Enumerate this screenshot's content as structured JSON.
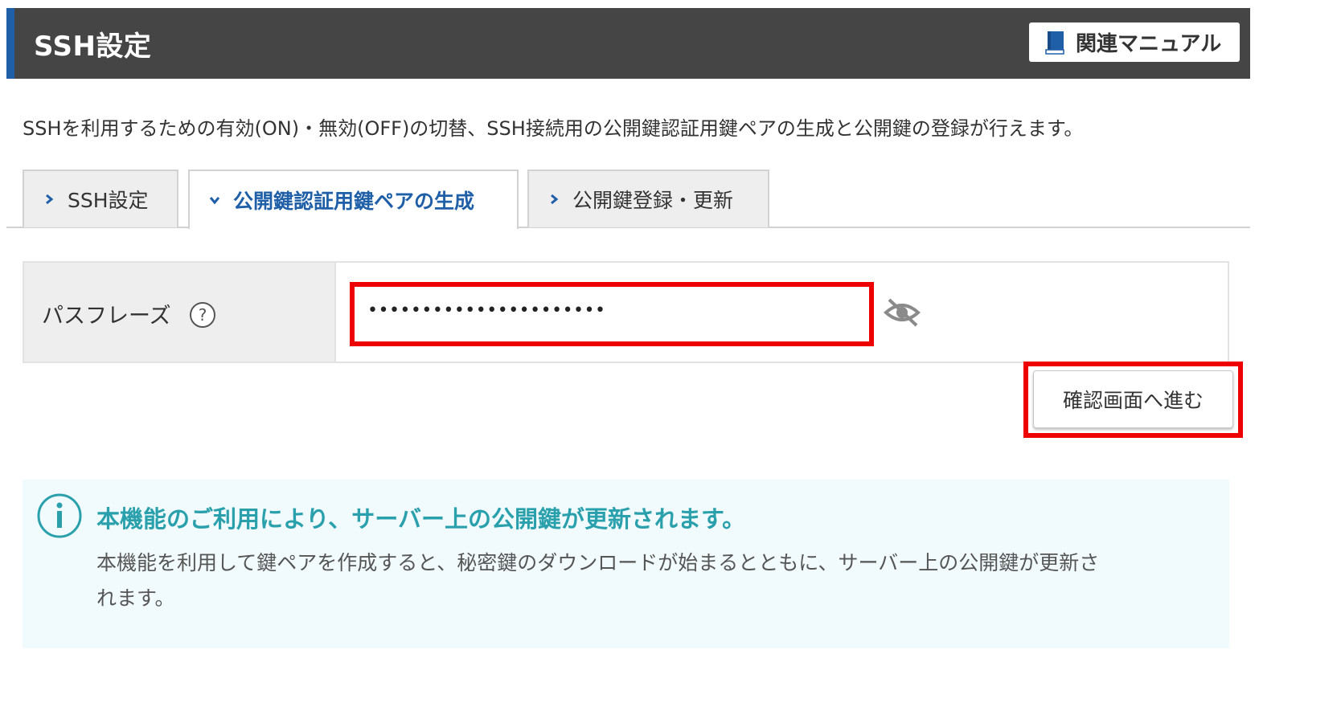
{
  "header": {
    "title": "SSH設定",
    "manual_label": "関連マニュアル",
    "manual_icon": "book-icon"
  },
  "description": "SSHを利用するための有効(ON)・無効(OFF)の切替、SSH接続用の公開鍵認証用鍵ペアの生成と公開鍵の登録が行えます。",
  "tabs": [
    {
      "label": "SSH設定",
      "active": false
    },
    {
      "label": "公開鍵認証用鍵ペアの生成",
      "active": true
    },
    {
      "label": "公開鍵登録・更新",
      "active": false
    }
  ],
  "form": {
    "passphrase_label": "パスフレーズ",
    "help_icon": "question-circle-icon",
    "passphrase_value": "••••••••••••••••••••••",
    "visibility_icon": "eye-slash-icon"
  },
  "confirm_button": "確認画面へ進む",
  "notice": {
    "icon": "info-icon",
    "title": "本機能のご利用により、サーバー上の公開鍵が更新されます。",
    "body_line1": "本機能を利用して鍵ペアを作成すると、秘密鍵のダウンロードが始まるとともに、サーバー上の公開鍵が更新さ",
    "body_line2": "れます。"
  },
  "colors": {
    "header_bg": "#454545",
    "accent_blue": "#1f5fa8",
    "highlight_red": "#ee0000",
    "notice_bg": "#f1fbfd",
    "notice_title": "#2aa0ad"
  }
}
